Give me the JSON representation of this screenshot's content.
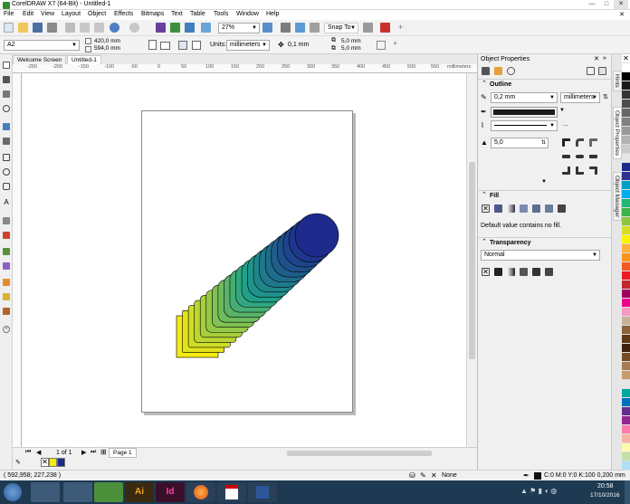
{
  "window": {
    "title": "CorelDRAW X7 (64-Bit) - Untitled-1",
    "controls": [
      "—",
      "□",
      "✕"
    ]
  },
  "menu": [
    "File",
    "Edit",
    "View",
    "Layout",
    "Object",
    "Effects",
    "Bitmaps",
    "Text",
    "Table",
    "Tools",
    "Window",
    "Help"
  ],
  "toolbar": {
    "zoom": "27%",
    "snap_to": "Snap To"
  },
  "propertybar": {
    "page_size": "A2",
    "width": "420,0 mm",
    "height": "594,0 mm",
    "units_label": "Units:",
    "units_value": "millimeters",
    "nudge": "0,1 mm",
    "dup_x": "5,0 mm",
    "dup_y": "5,0 mm"
  },
  "doc_tabs": [
    "Welcome Screen",
    "Untitled-1"
  ],
  "hruler_labels": [
    "-250",
    "-200",
    "-150",
    "-100",
    "-50",
    "0",
    "50",
    "100",
    "150",
    "200",
    "250",
    "300",
    "350",
    "400",
    "450",
    "500",
    "550",
    "millimeters"
  ],
  "page_nav": {
    "counter": "1 of 1",
    "page_tab": "Page 1"
  },
  "status": {
    "coords": "( 592,958; 227,238 )",
    "fill": "None",
    "outline": "C:0 M:0 Y:0 K:100  0,200 mm"
  },
  "panel": {
    "title": "Object Properties",
    "outline_header": "Outline",
    "outline_width": "0,2 mm",
    "outline_units": "millimeters",
    "outline_color": "#1a1a1a",
    "miter": "5,0",
    "ellipsis": "...",
    "fill_header": "Fill",
    "fill_message": "Default value contains no fill.",
    "transparency_header": "Transparency",
    "transparency_mode": "Normal"
  },
  "side_tabs": [
    "Hints",
    "Object Properties",
    "Object Manager"
  ],
  "taskbar": {
    "time": "20:58",
    "date": "17/10/2016"
  },
  "blend": {
    "start_color": "#f5ea10",
    "end_color": "#1e2a8c",
    "steps": 20
  },
  "palette": [
    "#ffffff",
    "#000000",
    "#1a1a1a",
    "#333333",
    "#4d4d4d",
    "#666666",
    "#808080",
    "#999999",
    "#b3b3b3",
    "#cccccc",
    "#e6e6e6",
    "#1e2a8c",
    "#2e3192",
    "#00a0c6",
    "#00aeef",
    "#22b573",
    "#39b54a",
    "#8dc63f",
    "#d7df23",
    "#fff200",
    "#fbb040",
    "#f7941d",
    "#f15a24",
    "#ed1c24",
    "#c1272d",
    "#9e005d",
    "#ec008c",
    "#f49ac2",
    "#c7b299",
    "#8c6239",
    "#603813",
    "#42210b",
    "#754c24",
    "#a67c52",
    "#c69c6d",
    "#e6e6e6",
    "#00a99d",
    "#0072bc",
    "#662d91",
    "#92278f",
    "#ff7bac",
    "#f9b3a5",
    "#fff9ae",
    "#c2e0a8",
    "#aedff7"
  ]
}
